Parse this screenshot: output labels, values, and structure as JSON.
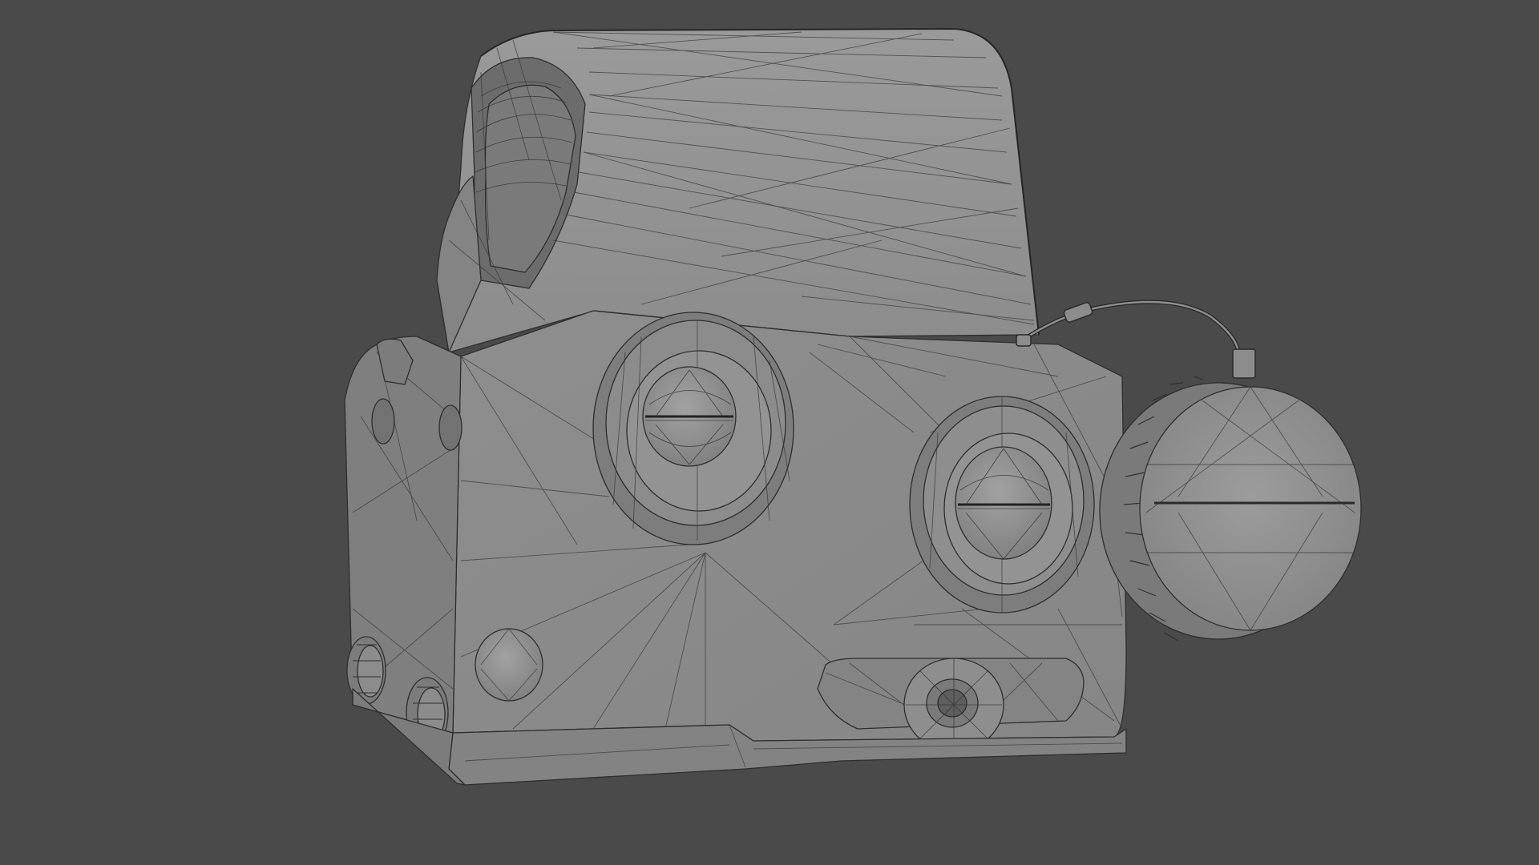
{
  "viewport": {
    "background_color": "#4a4a4a",
    "shading_mode": "solid-wireframe",
    "model_base_color": "#8a8a8a",
    "wireframe_color": "#333333"
  },
  "model": {
    "subject": "holographic-sight",
    "parts": [
      "hood",
      "body",
      "left-brightness-button",
      "right-brightness-button",
      "battery-cap",
      "lanyard-cable",
      "cross-bolt-knob",
      "side-mount-screws",
      "mount-base"
    ]
  }
}
